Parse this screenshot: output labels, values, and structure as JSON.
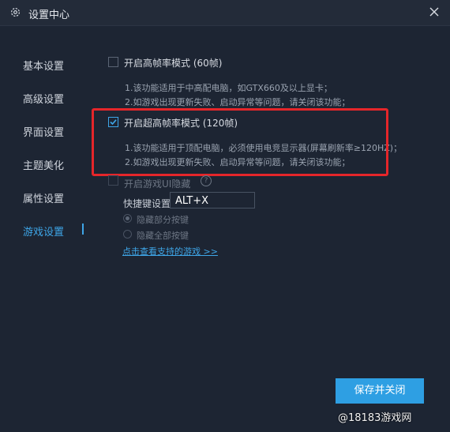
{
  "window": {
    "title": "设置中心",
    "icon": "gear-icon",
    "close_icon": "close-icon"
  },
  "sidebar": {
    "items": [
      {
        "label": "基本设置"
      },
      {
        "label": "高级设置"
      },
      {
        "label": "界面设置"
      },
      {
        "label": "主题美化"
      },
      {
        "label": "属性设置"
      },
      {
        "label": "游戏设置",
        "active": true
      }
    ]
  },
  "options": {
    "high_fps": {
      "label": "开启高帧率模式 (60帧)",
      "checked": false,
      "desc1": "1.该功能适用于中高配电脑，如GTX660及以上显卡；",
      "desc2": "2.如游戏出现更新失败、启动异常等问题，请关闭该功能；"
    },
    "ultra_fps": {
      "label": "开启超高帧率模式 (120帧)",
      "checked": true,
      "desc1": "1.该功能适用于顶配电脑，必须使用电竞显示器(屏幕刷新率≥120HZ)；",
      "desc2": "2.如游戏出现更新失败、启动异常等问题，请关闭该功能；"
    },
    "hide_ui": {
      "label": "开启游戏UI隐藏",
      "checked": false,
      "help_icon": "question-icon"
    }
  },
  "hotkey": {
    "label": "快捷键设置",
    "value": "ALT+X"
  },
  "radios": [
    {
      "label": "隐藏部分按键",
      "selected": true
    },
    {
      "label": "隐藏全部按键",
      "selected": false
    }
  ],
  "link": {
    "label": "点击查看支持的游戏 >>"
  },
  "buttons": {
    "save": "保存并关闭"
  },
  "watermark": "@18183游戏网",
  "colors": {
    "background": "#1d2533",
    "accent": "#3ea6e8",
    "highlight": "#e5262a"
  }
}
